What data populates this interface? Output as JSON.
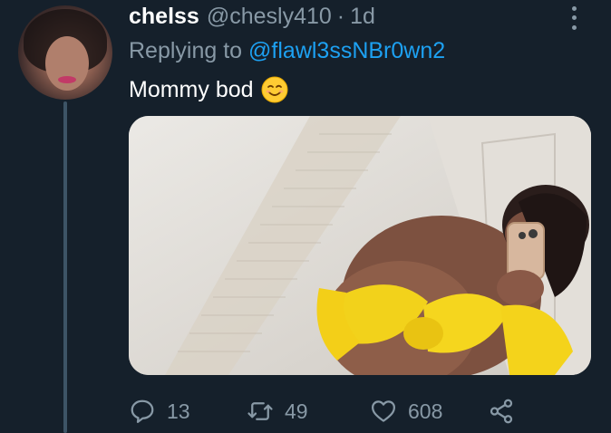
{
  "tweet": {
    "display_name": "chelss",
    "handle": "@chesly410",
    "separator": "·",
    "time": "1d",
    "reply_prefix": "Replying to ",
    "reply_mention": "@flawl3ssNBr0wn2",
    "text": "Mommy bod",
    "emoji_icon": "smiling-face-emoji",
    "media_description_icon": "photo"
  },
  "actions": {
    "reply_count": "13",
    "retweet_count": "49",
    "like_count": "608"
  },
  "colors": {
    "background": "#15202b",
    "secondary_text": "#8899a6",
    "link": "#1da1f2",
    "thread_line": "#3d5466"
  }
}
